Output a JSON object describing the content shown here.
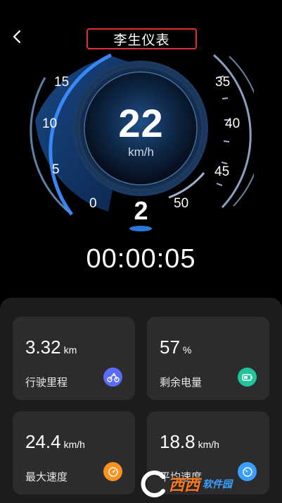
{
  "header": {
    "title": "李生仪表"
  },
  "gauge": {
    "speed": "22",
    "unit": "km/h",
    "gear": "2",
    "left_ticks": [
      "0",
      "5",
      "10",
      "15"
    ],
    "right_ticks": [
      "35",
      "40",
      "45",
      "50"
    ]
  },
  "timer": "00:00:05",
  "stats": {
    "distance": {
      "value": "3.32",
      "unit": "km",
      "label": "行驶里程",
      "icon": "bicycle-icon",
      "color": "#5b6cf6"
    },
    "battery": {
      "value": "57",
      "unit": "%",
      "label": "剩余电量",
      "icon": "battery-icon",
      "color": "#22c29a"
    },
    "max_speed": {
      "value": "24.4",
      "unit": "km/h",
      "label": "最大速度",
      "icon": "speedometer-icon",
      "color": "#f7931e"
    },
    "avg_speed": {
      "value": "18.8",
      "unit": "km/h",
      "label": "平均速度",
      "icon": "gauge-icon",
      "color": "#3aa0ff"
    }
  },
  "watermark": {
    "text": "西西",
    "sub": "软件园"
  },
  "colors": {
    "accent": "#2f8cff",
    "panel": "#1c1c1e",
    "card": "#2c2c2e",
    "highlight": "#e02f2f"
  }
}
